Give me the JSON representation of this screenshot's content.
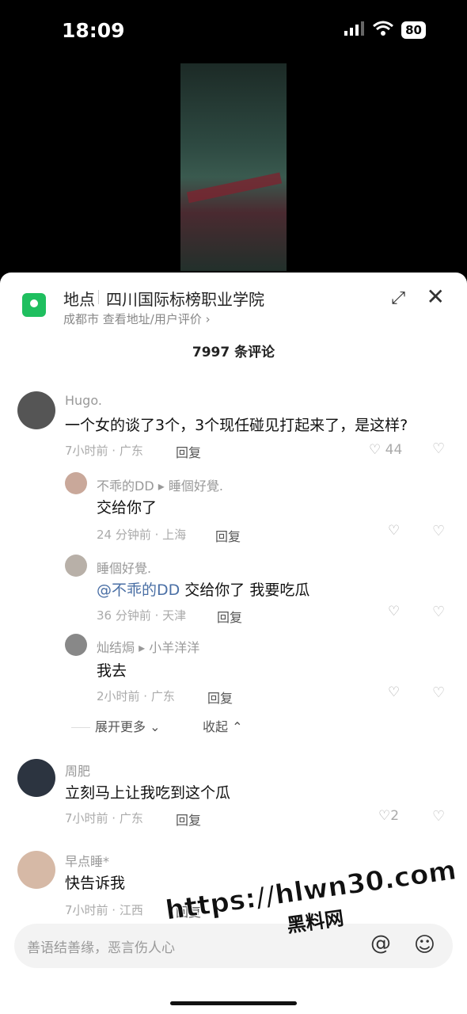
{
  "status": {
    "time": "18:09",
    "battery": "80"
  },
  "location": {
    "label": "地点",
    "name": "四川国际标榜职业学院",
    "sub": "成都市  查看地址/用户评价 ›"
  },
  "comment_count": "7997 条评论",
  "comments": [
    {
      "name": "Hugo.",
      "text": "一个女的谈了3个，3个现任碰见打起来了，是这样?",
      "meta": "7小时前 · 广东",
      "reply": "回复",
      "likes": "44"
    },
    {
      "name": "不乖的DD ▸ 睡個好覺.",
      "text": "交给你了",
      "meta": "24 分钟前 · 上海",
      "reply": "回复"
    },
    {
      "name": "睡個好覺.",
      "mention": "@不乖的DD",
      "text": " 交给你了 我要吃瓜",
      "meta": "36 分钟前 · 天津",
      "reply": "回复"
    },
    {
      "name": "灿结焗 ▸ 小羊洋洋",
      "text": "我去",
      "meta": "2小时前 · 广东",
      "reply": "回复"
    },
    {
      "name": "周肥",
      "text": "立刻马上让我吃到这个瓜",
      "meta": "7小时前 · 广东",
      "reply": "回复",
      "likes": "2"
    },
    {
      "name": "早点睡*",
      "text": "快告诉我",
      "meta": "7小时前 · 江西",
      "reply": "回复"
    }
  ],
  "expand_more": "展开更多 ⌄",
  "collapse": "收起 ⌃",
  "input": {
    "placeholder": "善语结善缘，恶言伤人心"
  },
  "watermark": {
    "line1": "https://hlwn30.com",
    "line2": "黑料网"
  }
}
